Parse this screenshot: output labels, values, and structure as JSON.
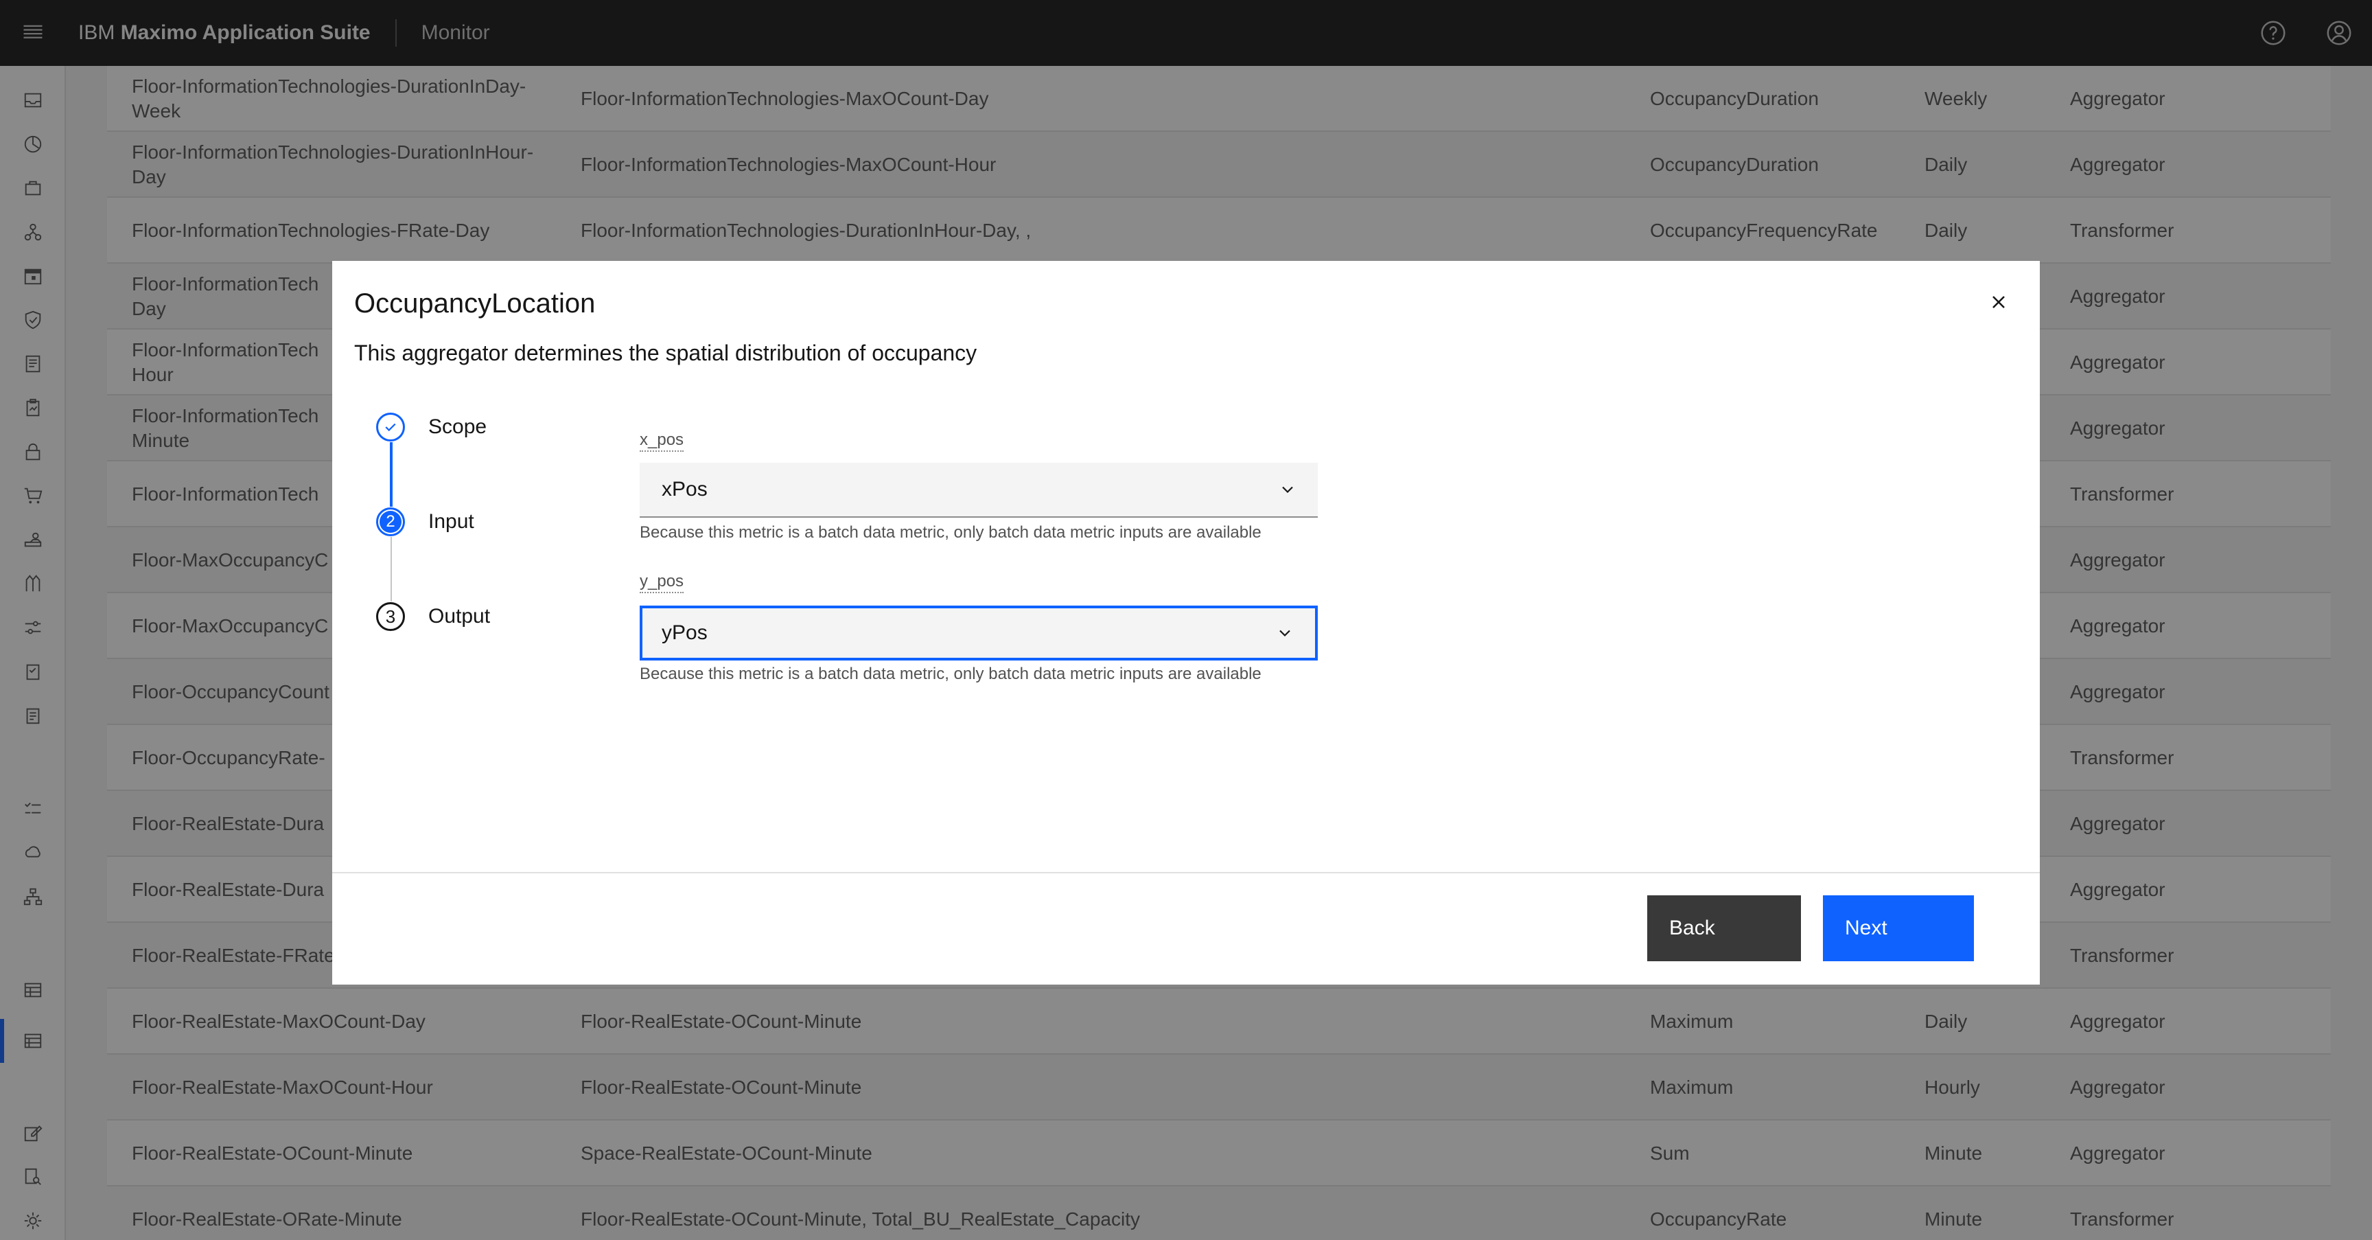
{
  "header": {
    "brand_prefix": "IBM",
    "brand_name": "Maximo Application Suite",
    "app": "Monitor",
    "icons": [
      "menu-icon",
      "help-icon",
      "user-avatar-icon"
    ]
  },
  "sidenav": {
    "icons": [
      "inbox-icon",
      "dashboard-icon",
      "asset-icon",
      "hierarchy-icon",
      "calendar-icon",
      "shield-icon",
      "document-icon",
      "report-icon",
      "lock-icon",
      "cart-icon",
      "tool-icon",
      "sensor-icon",
      "settings-sliders-icon",
      "clipboard-icon",
      "checklist-icon",
      "list-icon",
      "weather-icon",
      "network-icon",
      "table-icon",
      "data-table-icon",
      "edit-icon",
      "doc-search-icon",
      "gear-icon"
    ]
  },
  "table": {
    "rows": [
      [
        "Floor-InformationTechnologies-DurationInDay-Week",
        "Floor-InformationTechnologies-MaxOCount-Day",
        "OccupancyDuration",
        "Weekly",
        "Aggregator"
      ],
      [
        "Floor-InformationTechnologies-DurationInHour-Day",
        "Floor-InformationTechnologies-MaxOCount-Hour",
        "OccupancyDuration",
        "Daily",
        "Aggregator"
      ],
      [
        "Floor-InformationTechnologies-FRate-Day",
        "Floor-InformationTechnologies-DurationInHour-Day, ,",
        "OccupancyFrequencyRate",
        "Daily",
        "Transformer"
      ],
      [
        "Floor-InformationTech\nDay",
        "",
        "",
        "",
        "Aggregator"
      ],
      [
        "Floor-InformationTech\nHour",
        "",
        "",
        "",
        "Aggregator"
      ],
      [
        "Floor-InformationTech\nMinute",
        "",
        "",
        "",
        "Aggregator"
      ],
      [
        "Floor-InformationTech",
        "",
        "",
        "",
        "Transformer"
      ],
      [
        "Floor-MaxOccupancyC",
        "",
        "",
        "",
        "Aggregator"
      ],
      [
        "Floor-MaxOccupancyC",
        "",
        "",
        "",
        "Aggregator"
      ],
      [
        "Floor-OccupancyCount",
        "",
        "",
        "",
        "Aggregator"
      ],
      [
        "Floor-OccupancyRate-",
        "",
        "",
        "",
        "Transformer"
      ],
      [
        "Floor-RealEstate-Dura",
        "",
        "",
        "",
        "Aggregator"
      ],
      [
        "Floor-RealEstate-Dura",
        "",
        "",
        "",
        "Aggregator"
      ],
      [
        "Floor-RealEstate-FRate",
        "",
        "",
        "",
        "Transformer"
      ],
      [
        "Floor-RealEstate-MaxOCount-Day",
        "Floor-RealEstate-OCount-Minute",
        "Maximum",
        "Daily",
        "Aggregator"
      ],
      [
        "Floor-RealEstate-MaxOCount-Hour",
        "Floor-RealEstate-OCount-Minute",
        "Maximum",
        "Hourly",
        "Aggregator"
      ],
      [
        "Floor-RealEstate-OCount-Minute",
        "Space-RealEstate-OCount-Minute",
        "Sum",
        "Minute",
        "Aggregator"
      ],
      [
        "Floor-RealEstate-ORate-Minute",
        "Floor-RealEstate-OCount-Minute, Total_BU_RealEstate_Capacity",
        "OccupancyRate",
        "Minute",
        "Transformer"
      ]
    ]
  },
  "modal": {
    "title": "OccupancyLocation",
    "description": "This aggregator determines the spatial distribution of occupancy",
    "steps": [
      {
        "label": "Scope",
        "state": "complete"
      },
      {
        "label": "Input",
        "number": "2",
        "state": "current"
      },
      {
        "label": "Output",
        "number": "3",
        "state": "incomplete"
      }
    ],
    "fields": [
      {
        "label": "x_pos",
        "value": "xPos",
        "helper": "Because this metric is a batch data metric, only batch data metric inputs are available"
      },
      {
        "label": "y_pos",
        "value": "yPos",
        "helper": "Because this metric is a batch data metric, only batch data metric inputs are available"
      }
    ],
    "back_label": "Back",
    "next_label": "Next"
  },
  "colors": {
    "primary": "#0f62fe",
    "header_bg": "#161616",
    "secondary_button": "#393939"
  }
}
